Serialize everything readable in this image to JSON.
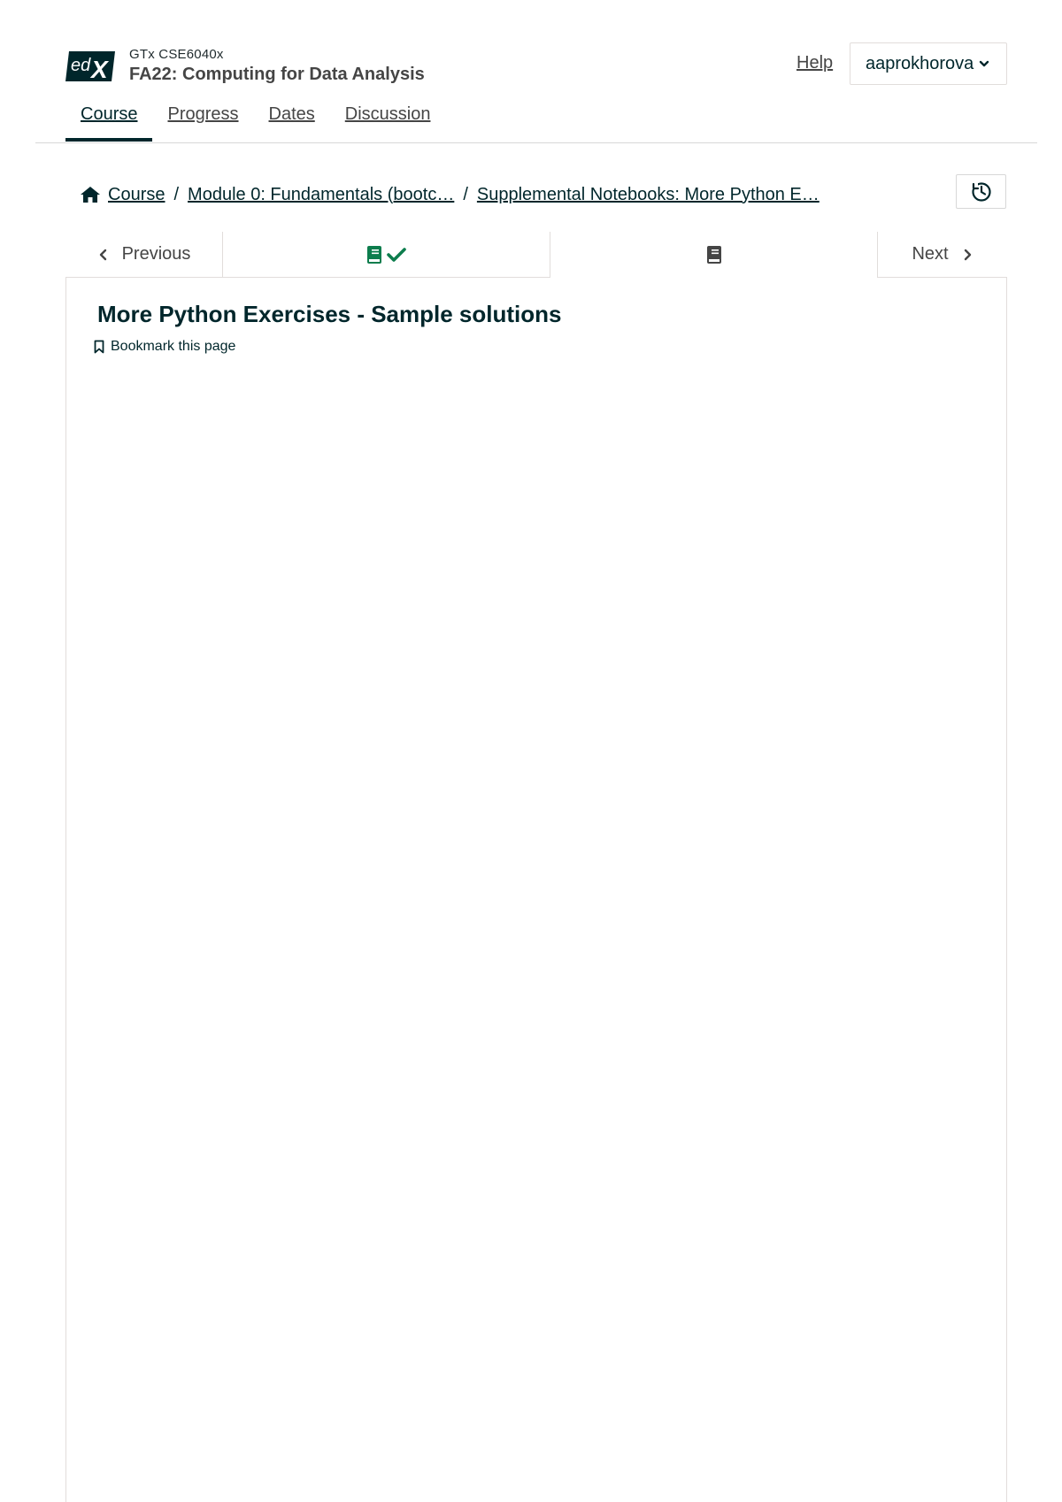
{
  "header": {
    "logo_text": "edX",
    "course_org": "GTx CSE6040x",
    "course_title": "FA22: Computing for Data Analysis",
    "help_label": "Help",
    "username": "aaprokhorova",
    "tabs": [
      {
        "label": "Course",
        "active": true
      },
      {
        "label": "Progress",
        "active": false
      },
      {
        "label": "Dates",
        "active": false
      },
      {
        "label": "Discussion",
        "active": false
      }
    ]
  },
  "breadcrumb": {
    "items": [
      "Course",
      "Module 0: Fundamentals (bootc…",
      "Supplemental Notebooks: More Python E…"
    ],
    "separator": "/"
  },
  "sequence_nav": {
    "previous_label": "Previous",
    "next_label": "Next",
    "units": [
      {
        "icon": "book-icon",
        "completed": true
      },
      {
        "icon": "book-icon",
        "completed": false,
        "current": true
      }
    ]
  },
  "unit": {
    "title": "More Python Exercises - Sample solutions",
    "bookmark_label": "Bookmark this page"
  },
  "colors": {
    "primary": "#00262b",
    "text_gray": "#454545",
    "complete_green": "#0d7d4d",
    "border": "#e1dddb"
  }
}
